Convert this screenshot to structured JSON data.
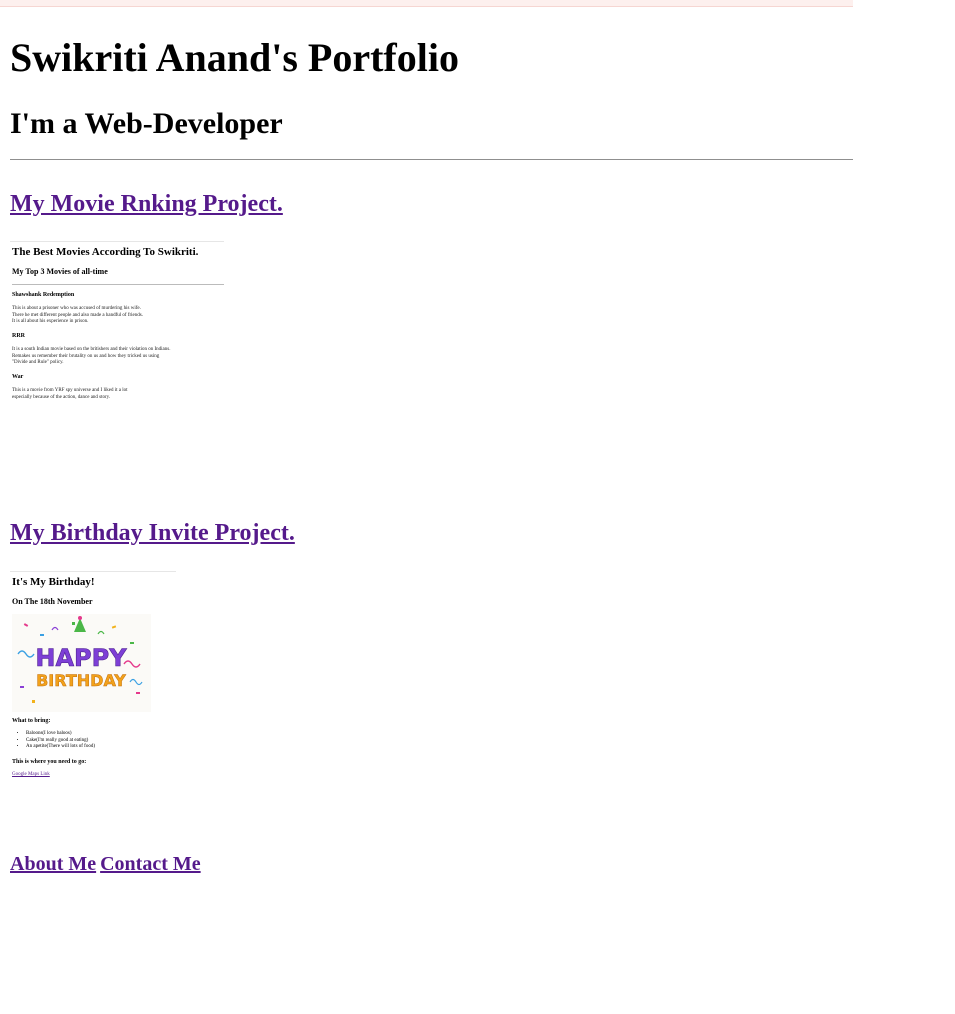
{
  "header": {
    "title": "Swikriti Anand's Portfolio",
    "subtitle": "I'm a Web-Developer"
  },
  "projects": [
    {
      "link_label": "My Movie Rnking Project.",
      "thumbnail": {
        "heading": "The Best Movies According To Swikriti.",
        "subheading": "My Top 3 Movies of all-time",
        "movies": [
          {
            "title": "Shawshank Redemption",
            "lines": [
              "This is about a prisoner who was accused of murdering his wife.",
              "There he met different people and also made a handful of friends.",
              "It is all about his experience in prison."
            ]
          },
          {
            "title": "RRR",
            "lines": [
              "It is a south Indian movie based on the britishers and their violation on Indians.",
              "Remakes us remember their brutality on us and how they tricked us using",
              "\"Divide and Rule\" policy."
            ]
          },
          {
            "title": "War",
            "lines": [
              "This is a movie from YRF spy universe and I liked it a lot",
              "especially because of the action, dance and story."
            ]
          }
        ]
      }
    },
    {
      "link_label": "My Birthday Invite Project.",
      "thumbnail": {
        "heading": "It's My Birthday!",
        "subheading": "On The 18th November",
        "image_text": [
          "HAPPY",
          "BIRTHDAY"
        ],
        "bring_heading": "What to bring:",
        "bring_items": [
          "Baloons(I love baloos)",
          "Cake(I'm really good at eating)",
          "An apetite(There will lots of food)"
        ],
        "location_heading": "This is where you need to go:",
        "map_link": "Google Maps Link"
      }
    }
  ],
  "footer": {
    "about": "About Me",
    "contact": "Contact Me"
  },
  "colors": {
    "link": "#551a8b",
    "top_bar": "#fdf0ee",
    "rule": "#8f8f8f"
  }
}
